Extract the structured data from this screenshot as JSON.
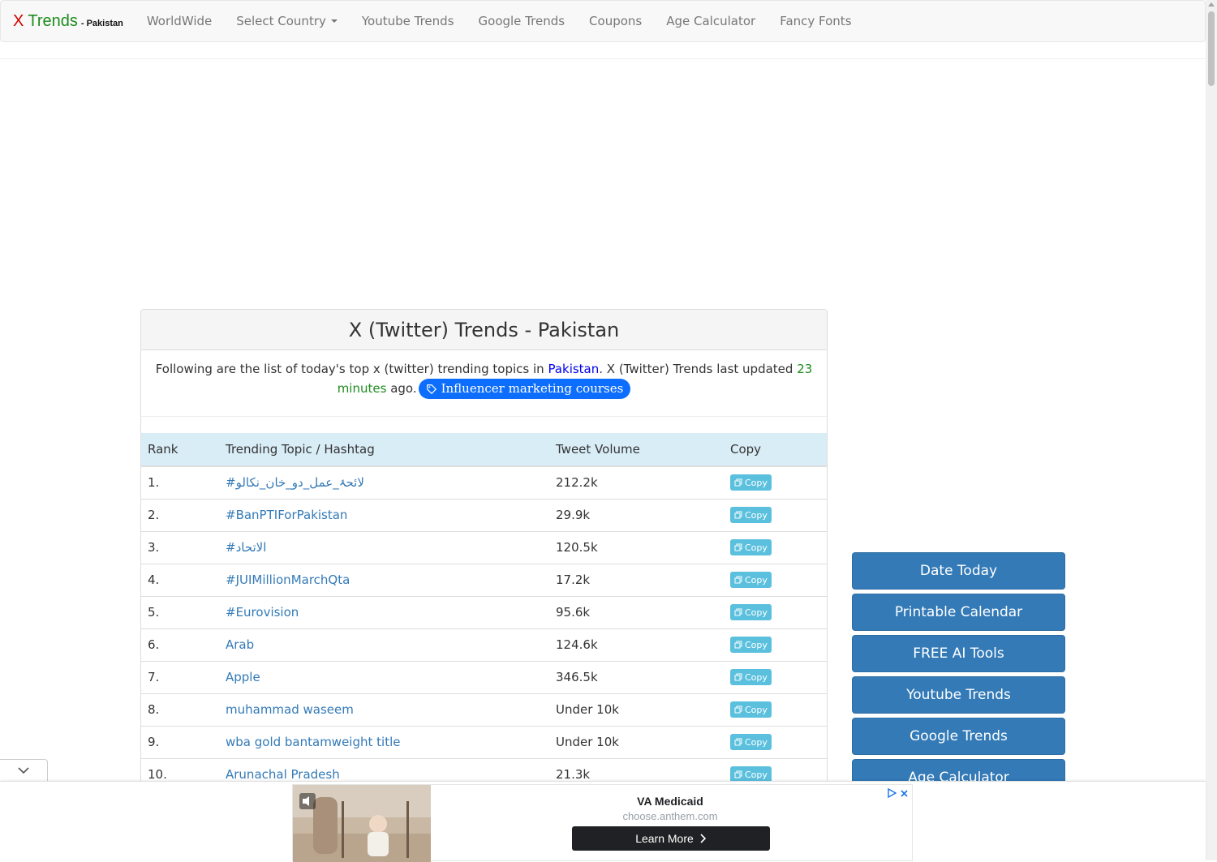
{
  "brand": {
    "x": "X",
    "trends": "Trends",
    "dash_country": "- Pakistan"
  },
  "nav": {
    "items": [
      "WorldWide",
      "Select Country",
      "Youtube Trends",
      "Google Trends",
      "Coupons",
      "Age Calculator",
      "Fancy Fonts"
    ]
  },
  "panel": {
    "title": "X (Twitter) Trends - Pakistan",
    "intro_before": "Following are the list of today's top x (twitter) trending topics in",
    "country": "Pakistan",
    "intro_mid": ". X (Twitter) Trends last updated",
    "updated": "23 minutes",
    "intro_after": "ago.",
    "course_button": "Influencer marketing courses"
  },
  "table": {
    "headers": [
      "Rank",
      "Trending Topic / Hashtag",
      "Tweet Volume",
      "Copy"
    ],
    "copy_label": "Copy",
    "rows": [
      {
        "rank": "1.",
        "topic": "#لائحۂ_عمل_دو_خان_نکالو",
        "volume": "212.2k"
      },
      {
        "rank": "2.",
        "topic": "#BanPTIForPakistan",
        "volume": "29.9k"
      },
      {
        "rank": "3.",
        "topic": "#الاتحاد",
        "volume": "120.5k"
      },
      {
        "rank": "4.",
        "topic": "#JUIMillionMarchQta",
        "volume": "17.2k"
      },
      {
        "rank": "5.",
        "topic": "#Eurovision",
        "volume": "95.6k"
      },
      {
        "rank": "6.",
        "topic": "Arab",
        "volume": "124.6k"
      },
      {
        "rank": "7.",
        "topic": "Apple",
        "volume": "346.5k"
      },
      {
        "rank": "8.",
        "topic": "muhammad waseem",
        "volume": "Under 10k"
      },
      {
        "rank": "9.",
        "topic": "wba gold bantamweight title",
        "volume": "Under 10k"
      },
      {
        "rank": "10.",
        "topic": "Arunachal Pradesh",
        "volume": "21.3k"
      }
    ]
  },
  "sidebar": {
    "buttons": [
      "Date Today",
      "Printable Calendar",
      "FREE AI Tools",
      "Youtube Trends",
      "Google Trends",
      "Age Calculator"
    ]
  },
  "ad": {
    "title": "VA Medicaid",
    "url": "choose.anthem.com",
    "cta": "Learn More"
  },
  "colors": {
    "accent": "#337ab7",
    "copy": "#5bc0de",
    "course": "#0d6efd",
    "green": "#1e8b1e",
    "header_row": "#d9edf7"
  }
}
